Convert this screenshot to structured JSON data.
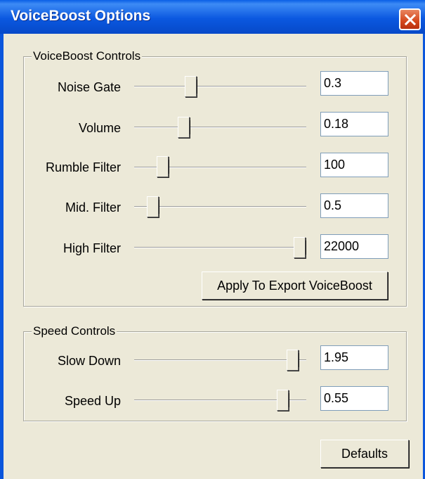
{
  "window": {
    "title": "VoiceBoost Options",
    "close_icon": "close-icon"
  },
  "voiceboost": {
    "group_label": "VoiceBoost Controls",
    "rows": [
      {
        "label": "Noise Gate",
        "value": "0.3",
        "slider_level": 0.33
      },
      {
        "label": "Volume",
        "value": "0.18",
        "slider_level": 0.3
      },
      {
        "label": "Rumble Filter",
        "value": "100",
        "slider_level": 0.18
      },
      {
        "label": "Mid. Filter",
        "value": "0.5",
        "slider_level": 0.11
      },
      {
        "label": "High Filter",
        "value": "22000",
        "slider_level": 1.0
      }
    ],
    "apply_label": "Apply To Export VoiceBoost"
  },
  "speed": {
    "group_label": "Speed Controls",
    "rows": [
      {
        "label": "Slow Down",
        "value": "1.95",
        "slider_level": 0.95
      },
      {
        "label": "Speed Up",
        "value": "0.55",
        "slider_level": 0.88
      }
    ]
  },
  "defaults_label": "Defaults",
  "colors": {
    "titlebar": "#0B58E0",
    "face": "#ECE9D8",
    "close": "#D4471C"
  }
}
